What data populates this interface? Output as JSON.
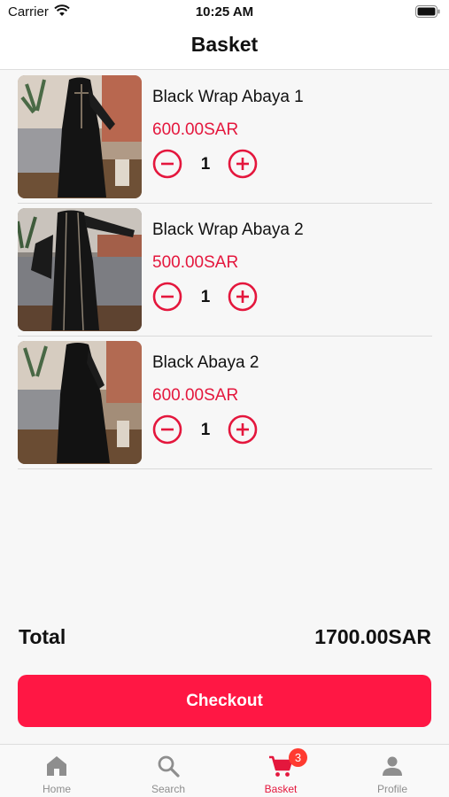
{
  "status_bar": {
    "carrier": "Carrier",
    "time": "10:25 AM"
  },
  "header": {
    "title": "Basket"
  },
  "items": [
    {
      "name": "Black Wrap Abaya 1",
      "price": "600.00SAR",
      "quantity": "1"
    },
    {
      "name": "Black Wrap Abaya 2",
      "price": "500.00SAR",
      "quantity": "1"
    },
    {
      "name": "Black Abaya 2",
      "price": "600.00SAR",
      "quantity": "1"
    }
  ],
  "summary": {
    "total_label": "Total",
    "total_value": "1700.00SAR"
  },
  "checkout": {
    "label": "Checkout"
  },
  "tabs": [
    {
      "label": "Home",
      "icon": "home-icon"
    },
    {
      "label": "Search",
      "icon": "search-icon"
    },
    {
      "label": "Basket",
      "icon": "cart-icon",
      "badge": "3",
      "active": true
    },
    {
      "label": "Profile",
      "icon": "person-icon"
    }
  ],
  "colors": {
    "accent": "#ff1744",
    "price": "#e4173d",
    "badge": "#ff3b30"
  }
}
